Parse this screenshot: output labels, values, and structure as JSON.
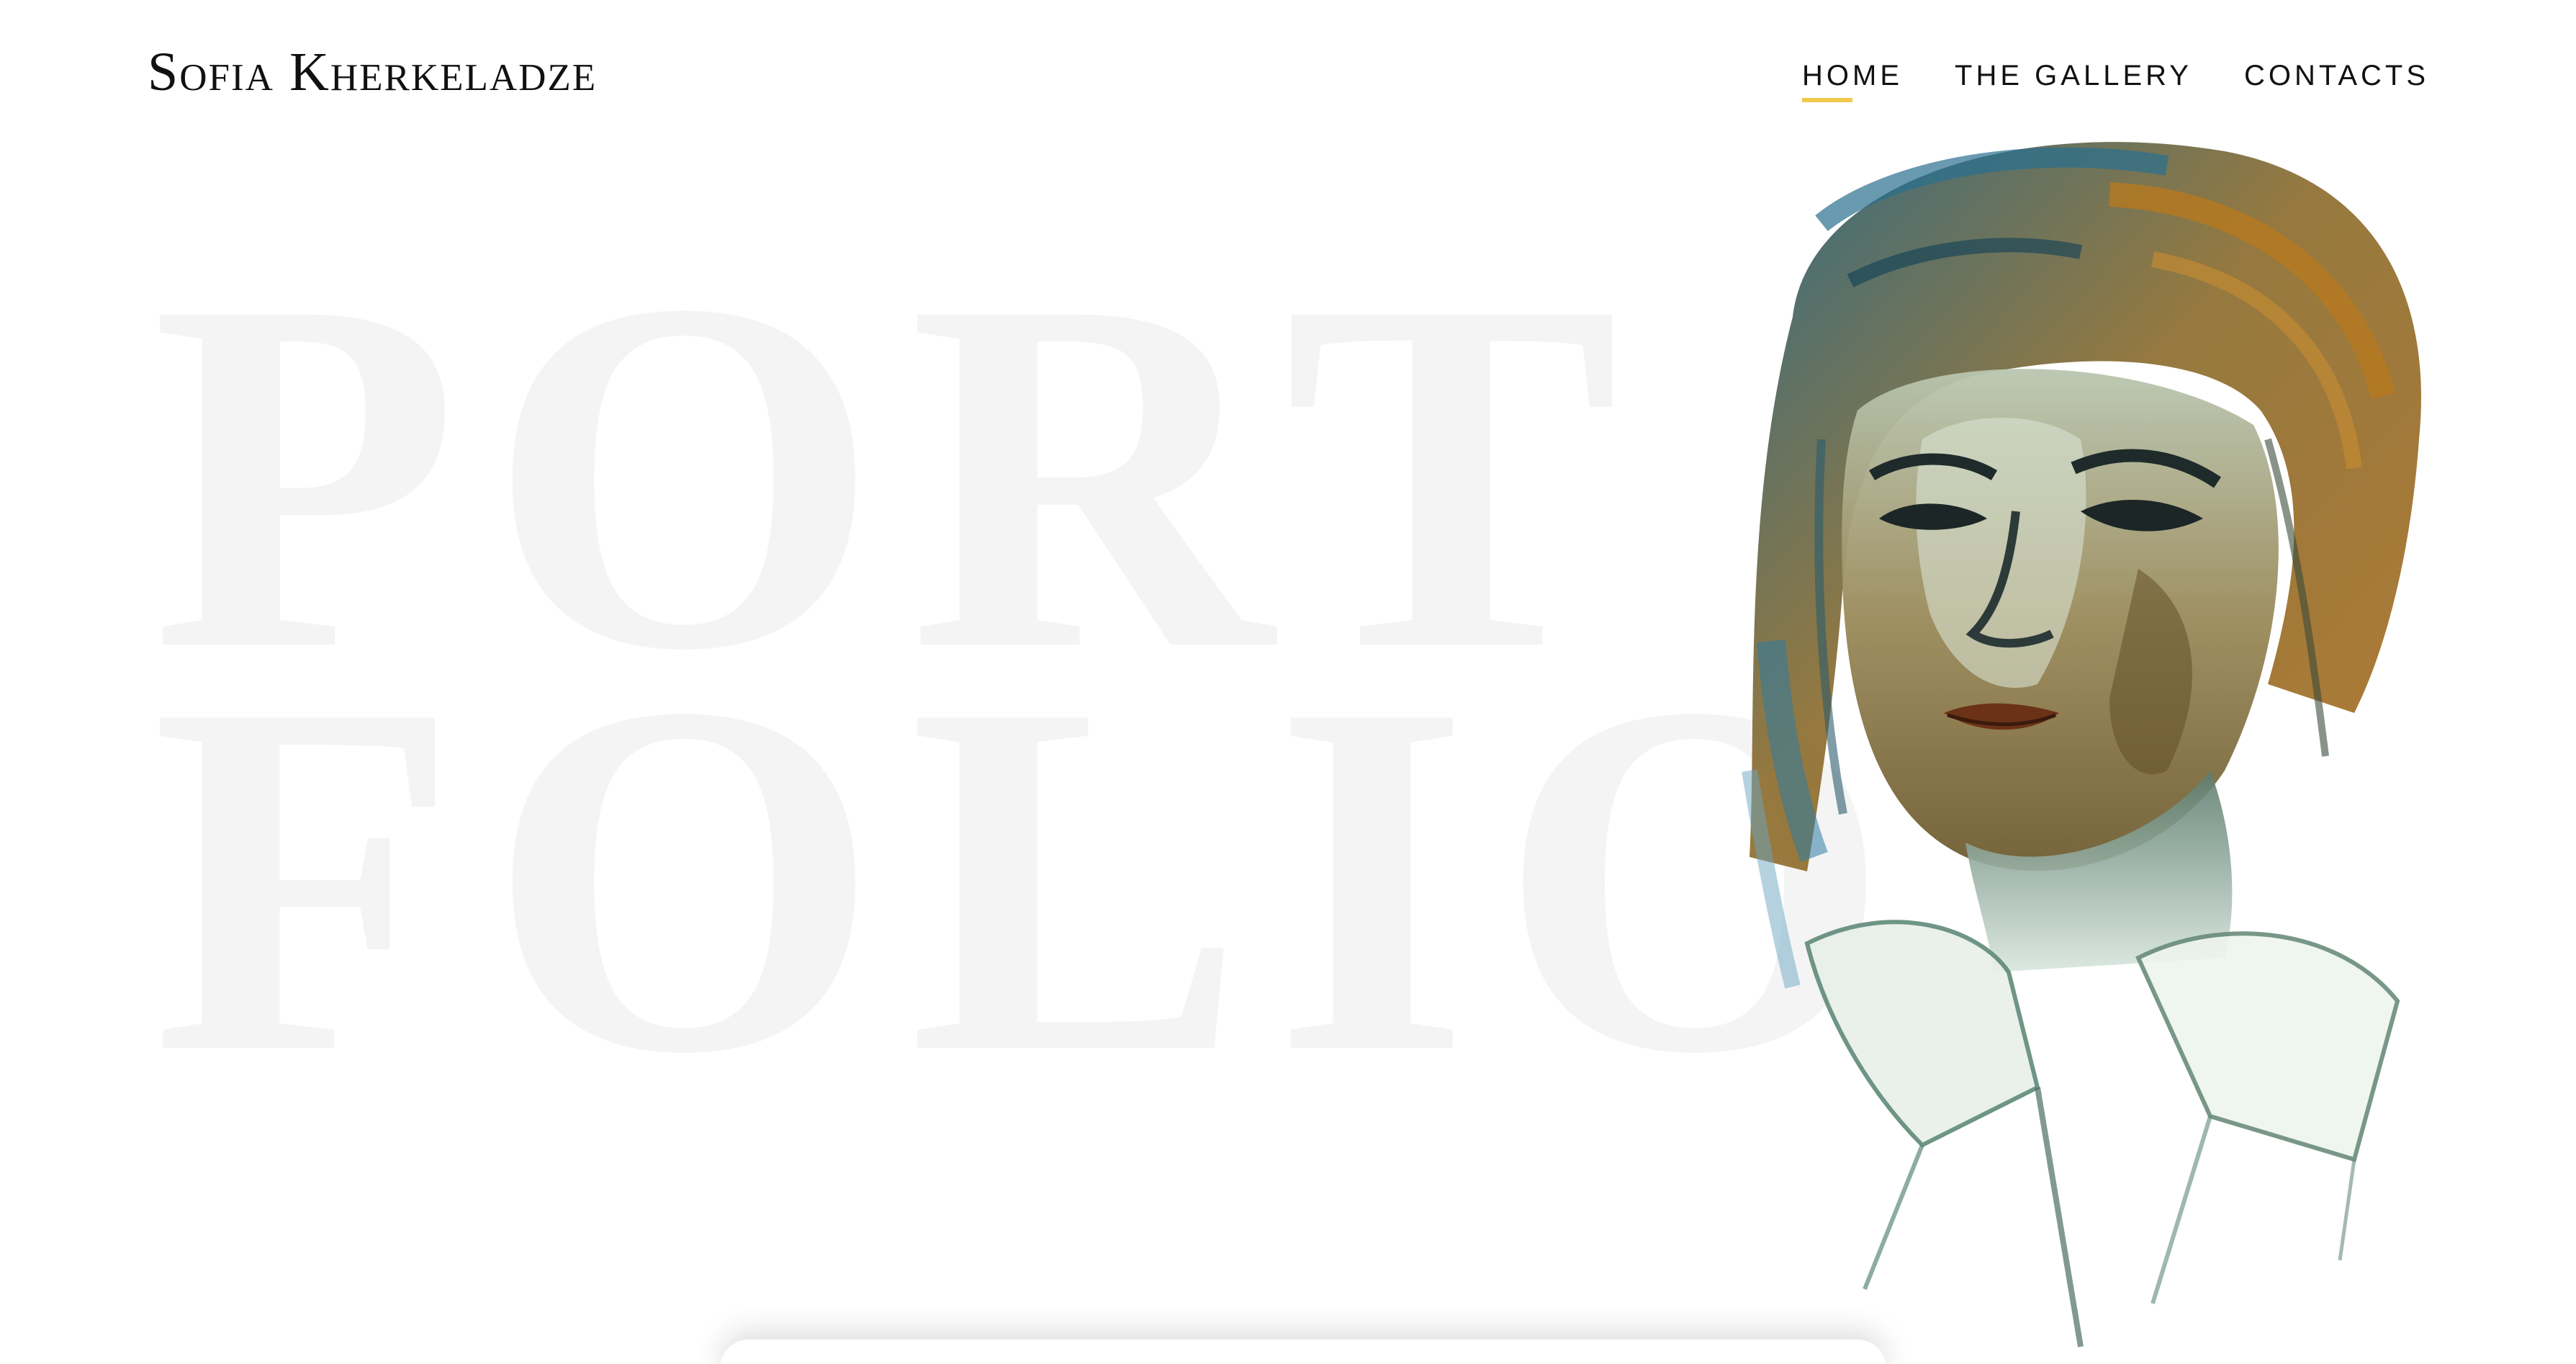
{
  "brand": {
    "name": "Sofia Kherkeladze"
  },
  "nav": {
    "items": [
      {
        "label": "HOME",
        "active": true
      },
      {
        "label": "THE GALLERY",
        "active": false
      },
      {
        "label": "CONTACTS",
        "active": false
      }
    ],
    "active_underline_color": "#f2c94c"
  },
  "hero": {
    "background_word_line1": "PORT",
    "background_word_line2": "FOLIO",
    "background_word_color": "#f4f4f4",
    "portrait_icon": "painted-portrait-illustration"
  },
  "colors": {
    "text": "#111111",
    "background": "#ffffff"
  }
}
